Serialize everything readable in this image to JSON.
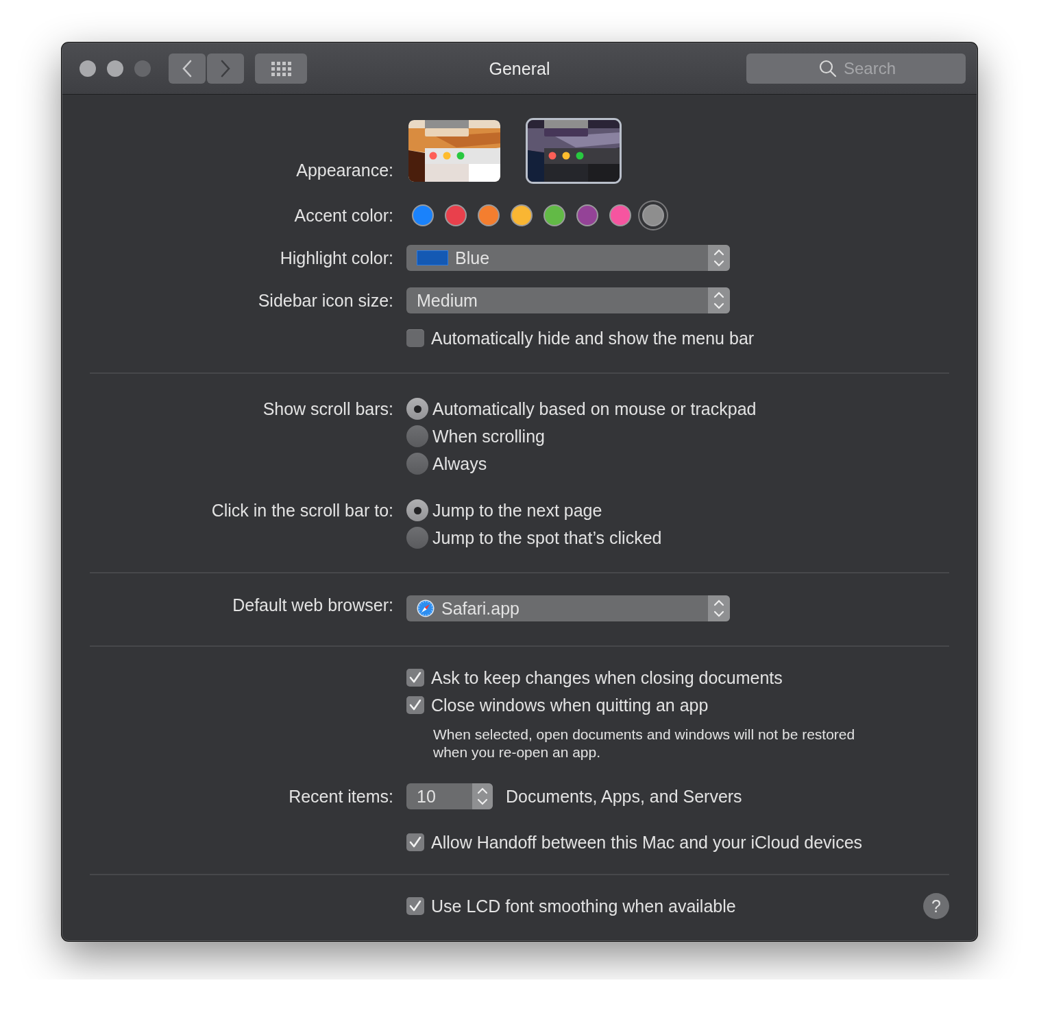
{
  "window": {
    "title": "General",
    "traffic_lights": [
      {
        "disabled": false
      },
      {
        "disabled": false
      },
      {
        "disabled": true
      }
    ],
    "back": {
      "disabled": false
    },
    "forward": {
      "disabled": true
    }
  },
  "search": {
    "placeholder": "Search"
  },
  "appearance": {
    "label": "Appearance:",
    "options": [
      {
        "kind": "light",
        "selected": false
      },
      {
        "kind": "dark",
        "selected": true
      }
    ]
  },
  "accent_color": {
    "label": "Accent color:",
    "options": [
      {
        "color": "#1a82fb",
        "selected": false
      },
      {
        "color": "#e9404c",
        "selected": false
      },
      {
        "color": "#f47e2f",
        "selected": false
      },
      {
        "color": "#f9b633",
        "selected": false
      },
      {
        "color": "#62ba46",
        "selected": false
      },
      {
        "color": "#944397",
        "selected": false
      },
      {
        "color": "#f655a0",
        "selected": false
      },
      {
        "color": "#8e8e8e",
        "selected": true
      }
    ]
  },
  "highlight_color": {
    "label": "Highlight color:",
    "value": "Blue",
    "color": "#1459b3"
  },
  "sidebar_icon_size": {
    "label": "Sidebar icon size:",
    "value": "Medium"
  },
  "auto_hide_menu_bar": {
    "label": "Automatically hide and show the menu bar",
    "checked": false
  },
  "show_scroll_bars": {
    "label": "Show scroll bars:",
    "options": [
      {
        "label": "Automatically based on mouse or trackpad",
        "selected": true
      },
      {
        "label": "When scrolling",
        "selected": false
      },
      {
        "label": "Always",
        "selected": false
      }
    ]
  },
  "click_in_scroll_bar": {
    "label": "Click in the scroll bar to:",
    "options": [
      {
        "label": "Jump to the next page",
        "selected": true
      },
      {
        "label": "Jump to the spot that’s clicked",
        "selected": false
      }
    ]
  },
  "default_web_browser": {
    "label": "Default web browser:",
    "value": "Safari.app"
  },
  "document_options": [
    {
      "label": "Ask to keep changes when closing documents",
      "checked": true
    },
    {
      "label": "Close windows when quitting an app",
      "checked": true
    }
  ],
  "close_windows_note": "When selected, open documents and windows will not be restored\nwhen you re-open an app.",
  "recent_items": {
    "label": "Recent items:",
    "value": "10",
    "suffix": "Documents, Apps, and Servers"
  },
  "handoff": {
    "label": "Allow Handoff between this Mac and your iCloud devices",
    "checked": true
  },
  "lcd_font_smoothing": {
    "label": "Use LCD font smoothing when available",
    "checked": true
  },
  "help_button": "?"
}
